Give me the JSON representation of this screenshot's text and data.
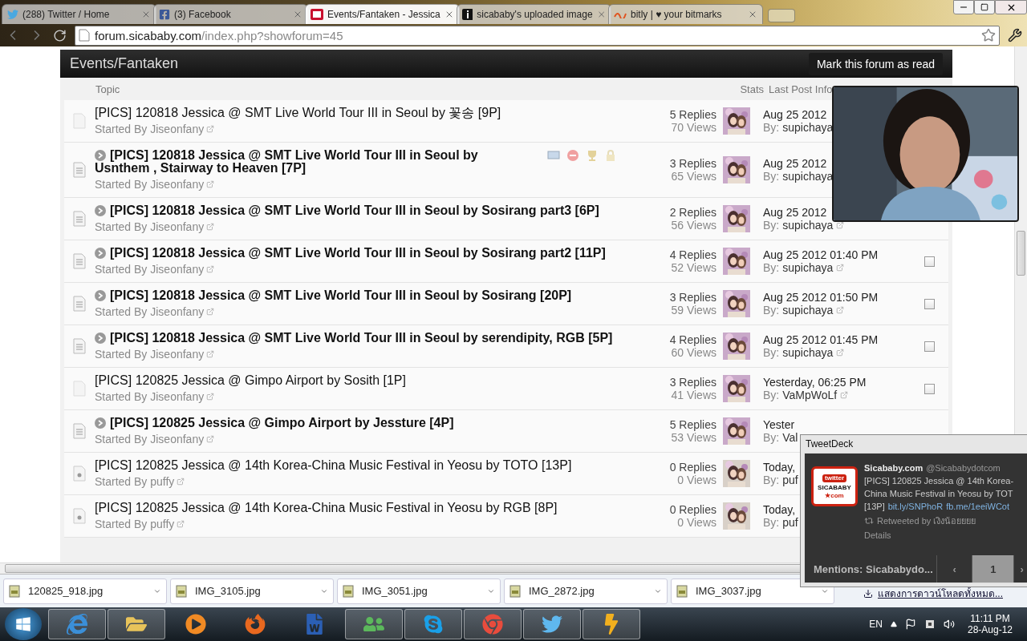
{
  "browser": {
    "tabs": [
      {
        "title": "(288) Twitter / Home",
        "kind": "twitter",
        "selected": false
      },
      {
        "title": "(3) Facebook",
        "kind": "facebook",
        "selected": false
      },
      {
        "title": "Events/Fantaken - Jessica",
        "kind": "forum",
        "selected": true
      },
      {
        "title": "sicababy's uploaded image",
        "kind": "info",
        "selected": false
      },
      {
        "title": "bitly | ♥ your bitmarks",
        "kind": "bitly",
        "selected": false
      }
    ],
    "url_host": "forum.sicababy.com",
    "url_path": "/index.php?showforum=45"
  },
  "forum": {
    "title": "Events/Fantaken",
    "mark_read": "Mark this forum as read",
    "columns": {
      "topic": "Topic",
      "stats": "Stats",
      "last_post": "Last Post Info"
    },
    "topics": [
      {
        "kind": "faded",
        "title": "[PICS] 120818 Jessica @ SMT Live World Tour III in Seoul by 꽃송 [9P]",
        "unread": false,
        "tools": false,
        "starter": "Started By Jiseonfany",
        "replies": "5 Replies",
        "views": "70 Views",
        "last_date": "Aug 25 2012",
        "by_label": "By:",
        "by_name": "supichaya"
      },
      {
        "kind": "lined",
        "title": "[PICS] 120818 Jessica @ SMT Live World Tour III in Seoul by Usnthem , Stairway to Heaven [7P]",
        "unread": true,
        "tools": true,
        "starter": "Started By Jiseonfany",
        "replies": "3 Replies",
        "views": "65 Views",
        "last_date": "Aug 25 2012",
        "by_label": "By:",
        "by_name": "supichaya"
      },
      {
        "kind": "lined",
        "title": "[PICS] 120818 Jessica @ SMT Live World Tour III in Seoul by Sosirang part3 [6P]",
        "unread": true,
        "tools": false,
        "starter": "Started By Jiseonfany",
        "replies": "2 Replies",
        "views": "56 Views",
        "last_date": "Aug 25 2012",
        "by_label": "By:",
        "by_name": "supichaya"
      },
      {
        "kind": "lined",
        "title": "[PICS] 120818 Jessica @ SMT Live World Tour III in Seoul by Sosirang part2 [11P]",
        "unread": true,
        "tools": false,
        "starter": "Started By Jiseonfany",
        "replies": "4 Replies",
        "views": "52 Views",
        "last_date": "Aug 25 2012 01:40 PM",
        "by_label": "By:",
        "by_name": "supichaya",
        "checked": false
      },
      {
        "kind": "lined",
        "title": "[PICS] 120818 Jessica @ SMT Live World Tour III in Seoul by Sosirang [20P]",
        "unread": true,
        "tools": false,
        "starter": "Started By Jiseonfany",
        "replies": "3 Replies",
        "views": "59 Views",
        "last_date": "Aug 25 2012 01:50 PM",
        "by_label": "By:",
        "by_name": "supichaya",
        "checked": false
      },
      {
        "kind": "lined",
        "title": "[PICS] 120818 Jessica @ SMT Live World Tour III in Seoul by serendipity, RGB [5P]",
        "unread": true,
        "tools": false,
        "starter": "Started By Jiseonfany",
        "replies": "4 Replies",
        "views": "60 Views",
        "last_date": "Aug 25 2012 01:45 PM",
        "by_label": "By:",
        "by_name": "supichaya",
        "checked": false
      },
      {
        "kind": "faded",
        "title": "[PICS] 120825 Jessica @ Gimpo Airport by Sosith [1P]",
        "unread": false,
        "tools": false,
        "starter": "Started By Jiseonfany",
        "replies": "3 Replies",
        "views": "41 Views",
        "last_date": "Yesterday, 06:25 PM",
        "by_label": "By:",
        "by_name": "VaMpWoLf",
        "checked": false
      },
      {
        "kind": "lined",
        "title": "[PICS] 120825 Jessica @ Gimpo Airport by Jessture [4P]",
        "unread": true,
        "tools": false,
        "starter": "Started By Jiseonfany",
        "replies": "5 Replies",
        "views": "53 Views",
        "last_date": "Yester",
        "by_label": "By:",
        "by_name": "Val"
      },
      {
        "kind": "dotted",
        "title": "[PICS] 120825 Jessica @ 14th Korea-China Music Festival in Yeosu by TOTO [13P]",
        "unread": false,
        "tools": false,
        "starter": "Started By puffy",
        "replies": "0 Replies",
        "views": "0 Views",
        "last_date": "Today,",
        "by_label": "By:",
        "by_name": "puf"
      },
      {
        "kind": "dotted",
        "title": "[PICS] 120825 Jessica @ 14th Korea-China Music Festival in Yeosu by RGB [8P]",
        "unread": false,
        "tools": false,
        "starter": "Started By puffy",
        "replies": "0 Replies",
        "views": "0 Views",
        "last_date": "Today,",
        "by_label": "By:",
        "by_name": "puf"
      }
    ]
  },
  "tweetdeck": {
    "title": "TweetDeck",
    "logo": {
      "top": "twitter",
      "main": "SICABABY",
      "sub": "★com"
    },
    "name": "Sicababy.com",
    "handle": "@Sicababydotcom",
    "lines": [
      "[PICS] 120825 Jessica @ 14th Korea-",
      "China Music Festival in Yeosu by TOT",
      "[13P]"
    ],
    "links": [
      "bit.ly/SNPhoR",
      "fb.me/1eeiWCot"
    ],
    "retweeted": "Retweeted by เงิงน้อยยยย",
    "details": "Details",
    "footer": "Mentions: Sicababydo...",
    "prev": "‹",
    "page": "1",
    "next": "›"
  },
  "downloads": {
    "items": [
      "120825_918.jpg",
      "IMG_3105.jpg",
      "IMG_3051.jpg",
      "IMG_2872.jpg",
      "IMG_3037.jpg"
    ],
    "show_all": "แสดงการดาวน์โหลดทั้งหมด..."
  },
  "taskbar": {
    "apps": [
      {
        "kind": "ie",
        "running": true
      },
      {
        "kind": "explorer",
        "running": true
      },
      {
        "kind": "media",
        "running": false
      },
      {
        "kind": "firefox",
        "running": false
      },
      {
        "kind": "word",
        "running": false
      },
      {
        "kind": "messenger",
        "running": true
      },
      {
        "kind": "skype",
        "running": true
      },
      {
        "kind": "chrome",
        "running": true
      },
      {
        "kind": "twitter",
        "running": true
      },
      {
        "kind": "winamp",
        "running": true
      }
    ],
    "language": "EN",
    "time": "11:11 PM",
    "date": "28-Aug-12"
  }
}
